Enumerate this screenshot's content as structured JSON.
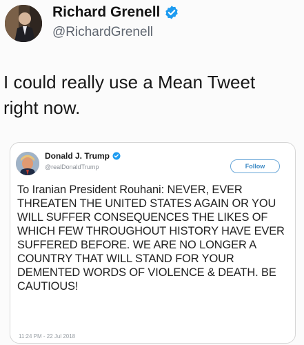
{
  "tweet": {
    "author_name": "Richard Grenell",
    "handle": "@RichardGrenell",
    "text": "I could really use a Mean Tweet right now."
  },
  "quoted_tweet": {
    "author_name": "Donald J. Trump",
    "handle": "@realDonaldTrump",
    "follow_label": "Follow",
    "text": "To Iranian President Rouhani: NEVER, EVER THREATEN THE UNITED STATES AGAIN OR YOU WILL SUFFER CONSEQUENCES THE LIKES OF WHICH FEW THROUGHOUT HISTORY HAVE EVER SUFFERED BEFORE. WE ARE NO LONGER A COUNTRY THAT WILL STAND FOR YOUR DEMENTED WORDS OF VIOLENCE & DEATH. BE CAUTIOUS!",
    "timestamp": "11:24 PM - 22 Jul 2018"
  },
  "colors": {
    "verified_blue": "#1d9bf0",
    "follow_blue": "#3b88c3"
  }
}
